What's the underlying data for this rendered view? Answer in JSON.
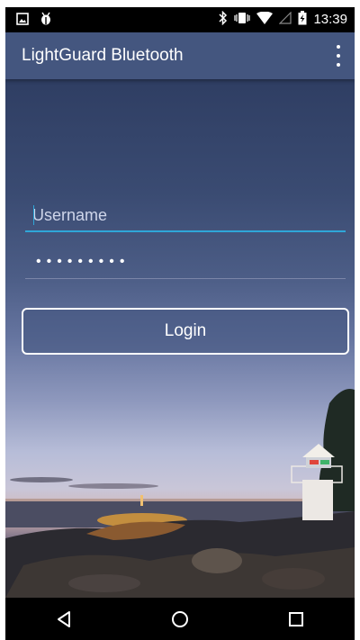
{
  "status_bar": {
    "time": "13:39",
    "left_icons": [
      "image-icon",
      "android-debug-icon"
    ],
    "right_icons": [
      "bluetooth-icon",
      "vibrate-icon",
      "wifi-icon",
      "cell-signal-icon",
      "battery-charging-icon"
    ]
  },
  "toolbar": {
    "title": "LightGuard Bluetooth",
    "menu_icon": "overflow-menu-icon"
  },
  "login_form": {
    "username": {
      "value": "",
      "placeholder": "Username"
    },
    "password": {
      "masked": "•••••••••"
    },
    "login_label": "Login"
  },
  "nav_bar": {
    "buttons": [
      "back-icon",
      "home-icon",
      "recents-icon"
    ]
  },
  "colors": {
    "toolbar": "#44567f",
    "accent": "#2fa7d8",
    "text": "#ffffff"
  }
}
